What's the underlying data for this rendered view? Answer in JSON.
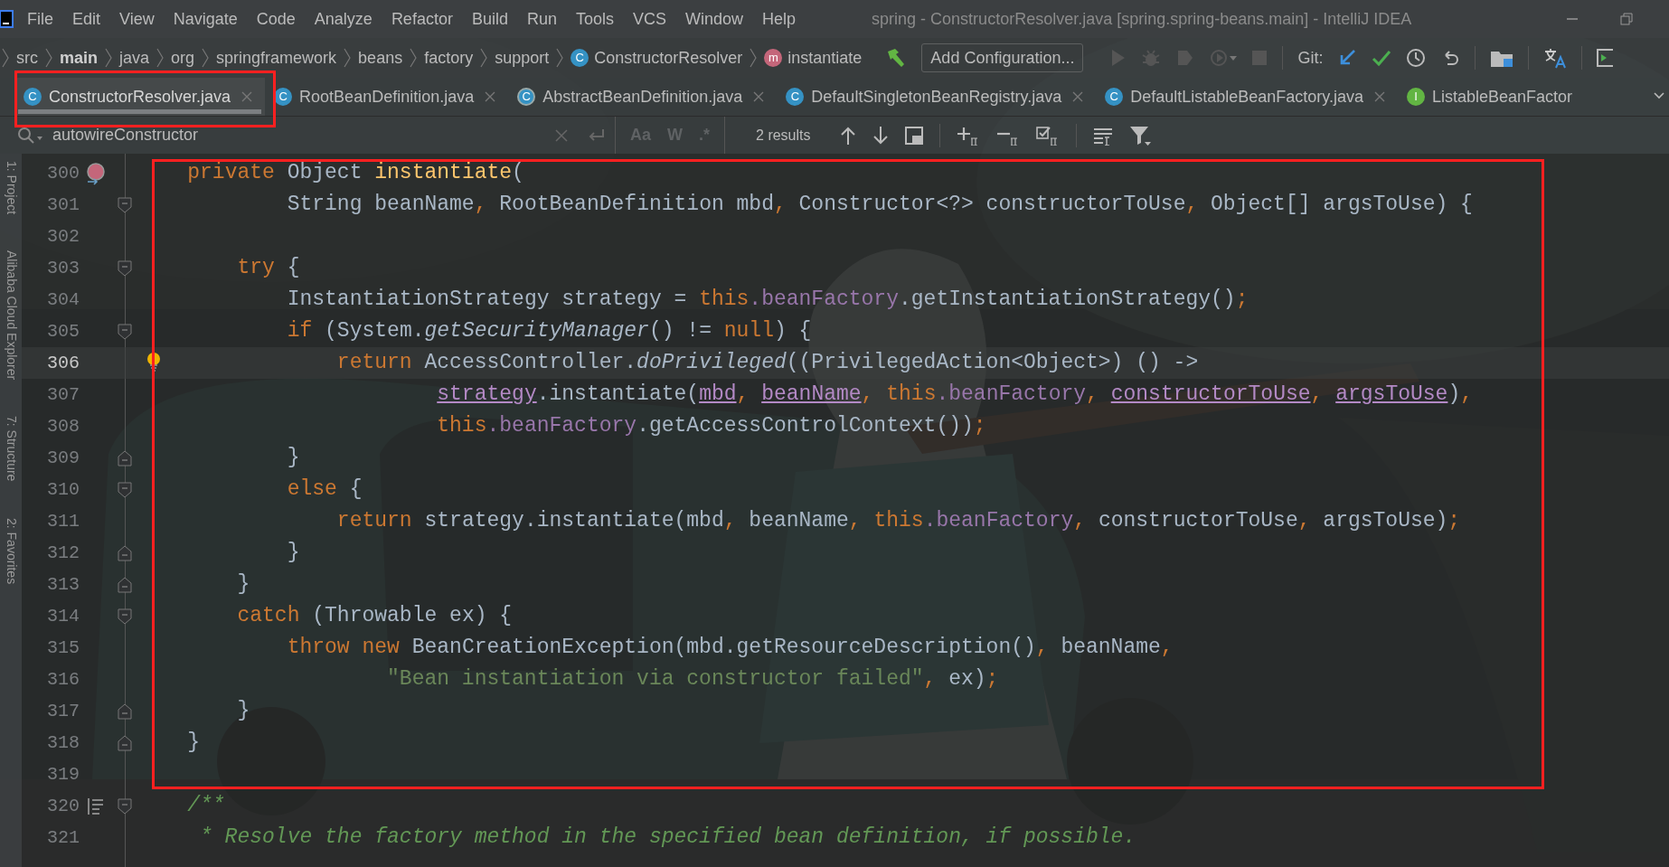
{
  "menu_bar": {
    "items": [
      "File",
      "Edit",
      "View",
      "Navigate",
      "Code",
      "Analyze",
      "Refactor",
      "Build",
      "Run",
      "Tools",
      "VCS",
      "Window",
      "Help"
    ]
  },
  "window": {
    "title": "spring - ConstructorResolver.java [spring.spring-beans.main] - IntelliJ IDEA"
  },
  "breadcrumbs": [
    {
      "label": "src",
      "kind": "folder"
    },
    {
      "label": "main",
      "kind": "bold"
    },
    {
      "label": "java",
      "kind": "folder"
    },
    {
      "label": "org",
      "kind": "folder"
    },
    {
      "label": "springframework",
      "kind": "folder"
    },
    {
      "label": "beans",
      "kind": "folder"
    },
    {
      "label": "factory",
      "kind": "folder"
    },
    {
      "label": "support",
      "kind": "folder"
    },
    {
      "label": "ConstructorResolver",
      "kind": "class",
      "icon_letter": "C"
    },
    {
      "label": "instantiate",
      "kind": "method",
      "icon_letter": "m"
    }
  ],
  "toolbar": {
    "run_config": "Add Configuration...",
    "vcs_label": "Git:"
  },
  "tabs": [
    {
      "label": "ConstructorResolver.java",
      "kind": "class",
      "icon_letter": "C",
      "selected": true
    },
    {
      "label": "RootBeanDefinition.java",
      "kind": "class",
      "icon_letter": "C",
      "selected": false
    },
    {
      "label": "AbstractBeanDefinition.java",
      "kind": "abstract",
      "icon_letter": "C",
      "selected": false
    },
    {
      "label": "DefaultSingletonBeanRegistry.java",
      "kind": "class",
      "icon_letter": "C",
      "selected": false
    },
    {
      "label": "DefaultListableBeanFactory.java",
      "kind": "class",
      "icon_letter": "C",
      "selected": false
    },
    {
      "label": "ListableBeanFactor",
      "kind": "interface",
      "icon_letter": "I",
      "selected": false
    }
  ],
  "find_bar": {
    "query": "autowireConstructor",
    "options": [
      {
        "label": "Aa",
        "on": false
      },
      {
        "label": "W",
        "on": false
      },
      {
        "label": ".*",
        "on": false
      }
    ],
    "result_count": "2 results"
  },
  "tool_strip": [
    "1: Project",
    "Alibaba Cloud Explorer",
    "7: Structure",
    "2: Favorites"
  ],
  "editor": {
    "lines": [
      {
        "number": "300",
        "current": false,
        "gutter_icon": {
          "kind": "override"
        },
        "tokens": [
          {
            "text": "    private ",
            "kind": "keyword"
          },
          {
            "text": "Object ",
            "kind": "plain"
          },
          {
            "text": "instantiate",
            "kind": "method"
          },
          {
            "text": "(",
            "kind": "plain"
          }
        ]
      },
      {
        "number": "301",
        "current": false,
        "fold_marker": {
          "kind": "start"
        },
        "tokens": [
          {
            "text": "            String beanName, RootBeanDefinition mbd, Constructor<?> constructorToUse, Object[] argsToUse) {",
            "kind": "plain"
          }
        ]
      },
      {
        "number": "302",
        "current": false
      },
      {
        "number": "303",
        "current": false,
        "fold_marker": {
          "kind": "start"
        },
        "tokens": [
          {
            "text": "        try",
            "kind": "keyword"
          },
          {
            "text": " {",
            "kind": "plain"
          }
        ]
      },
      {
        "number": "304",
        "current": false,
        "tokens": [
          {
            "text": "            InstantiationStrategy strategy = ",
            "kind": "plain"
          },
          {
            "text": "this",
            "kind": "keyword"
          },
          {
            "text": ".beanFactory",
            "kind": "field"
          },
          {
            "text": ".getInstantiationStrategy();",
            "kind": "plain"
          }
        ]
      },
      {
        "number": "305",
        "current": false,
        "fold_marker": {
          "kind": "start"
        },
        "tokens": [
          {
            "text": "            if ",
            "kind": "keyword"
          },
          {
            "text": "(System.",
            "kind": "plain"
          },
          {
            "text": "getSecurityManager",
            "kind": "static"
          },
          {
            "text": "() != ",
            "kind": "plain"
          },
          {
            "text": "null",
            "kind": "keyword"
          },
          {
            "text": ") {",
            "kind": "plain"
          }
        ]
      },
      {
        "number": "306",
        "current": true,
        "gutter_icon": {
          "kind": "bulb"
        },
        "tokens": [
          {
            "text": "                return ",
            "kind": "keyword"
          },
          {
            "text": "AccessController.",
            "kind": "plain"
          },
          {
            "text": "doPrivileged",
            "kind": "static"
          },
          {
            "text": "((PrivilegedAction<Object>) () ->",
            "kind": "plain"
          }
        ]
      },
      {
        "number": "307",
        "current": false,
        "tokens": [
          {
            "text": "                        strategy",
            "kind": "captured"
          },
          {
            "text": ".instantiate(",
            "kind": "plain"
          },
          {
            "text": "mbd",
            "kind": "captured"
          },
          {
            "text": ", ",
            "kind": "plain"
          },
          {
            "text": "beanName",
            "kind": "captured"
          },
          {
            "text": ", ",
            "kind": "plain"
          },
          {
            "text": "this",
            "kind": "keyword"
          },
          {
            "text": ".beanFactory",
            "kind": "field"
          },
          {
            "text": ", ",
            "kind": "plain"
          },
          {
            "text": "constructorToUse",
            "kind": "captured"
          },
          {
            "text": ", ",
            "kind": "plain"
          },
          {
            "text": "argsToUse",
            "kind": "captured"
          },
          {
            "text": "),",
            "kind": "plain"
          }
        ]
      },
      {
        "number": "308",
        "current": false,
        "tokens": [
          {
            "text": "                        this",
            "kind": "keyword"
          },
          {
            "text": ".beanFactory",
            "kind": "field"
          },
          {
            "text": ".getAccessControlContext());",
            "kind": "plain"
          }
        ]
      },
      {
        "number": "309",
        "current": false,
        "fold_marker": {
          "kind": "end"
        },
        "tokens": [
          {
            "text": "            }",
            "kind": "plain"
          }
        ]
      },
      {
        "number": "310",
        "current": false,
        "fold_marker": {
          "kind": "start"
        },
        "tokens": [
          {
            "text": "            else",
            "kind": "keyword"
          },
          {
            "text": " {",
            "kind": "plain"
          }
        ]
      },
      {
        "number": "311",
        "current": false,
        "tokens": [
          {
            "text": "                return ",
            "kind": "keyword"
          },
          {
            "text": "strategy.instantiate(mbd, beanName, ",
            "kind": "plain"
          },
          {
            "text": "this",
            "kind": "keyword"
          },
          {
            "text": ".beanFactory",
            "kind": "field"
          },
          {
            "text": ", constructorToUse, argsToUse);",
            "kind": "plain"
          }
        ]
      },
      {
        "number": "312",
        "current": false,
        "fold_marker": {
          "kind": "end"
        },
        "tokens": [
          {
            "text": "            }",
            "kind": "plain"
          }
        ]
      },
      {
        "number": "313",
        "current": false,
        "fold_marker": {
          "kind": "end"
        },
        "tokens": [
          {
            "text": "        }",
            "kind": "plain"
          }
        ]
      },
      {
        "number": "314",
        "current": false,
        "fold_marker": {
          "kind": "start"
        },
        "tokens": [
          {
            "text": "        catch ",
            "kind": "keyword"
          },
          {
            "text": "(Throwable ex) {",
            "kind": "plain"
          }
        ]
      },
      {
        "number": "315",
        "current": false,
        "tokens": [
          {
            "text": "            throw new ",
            "kind": "keyword"
          },
          {
            "text": "BeanCreationException(mbd.getResourceDescription(), beanName,",
            "kind": "plain"
          }
        ]
      },
      {
        "number": "316",
        "current": false,
        "tokens": [
          {
            "text": "                    \"Bean instantiation via constructor failed\"",
            "kind": "string"
          },
          {
            "text": ", ex);",
            "kind": "plain"
          }
        ]
      },
      {
        "number": "317",
        "current": false,
        "fold_marker": {
          "kind": "end"
        },
        "tokens": [
          {
            "text": "        }",
            "kind": "plain"
          }
        ]
      },
      {
        "number": "318",
        "current": false,
        "fold_marker": {
          "kind": "end"
        },
        "tokens": [
          {
            "text": "    }",
            "kind": "plain"
          }
        ]
      },
      {
        "number": "319",
        "current": false
      },
      {
        "number": "320",
        "current": false,
        "gutter_icon": {
          "kind": "doc"
        },
        "fold_marker": {
          "kind": "start"
        },
        "tokens": [
          {
            "text": "    /**",
            "kind": "comment"
          }
        ]
      },
      {
        "number": "321",
        "current": false,
        "tokens": [
          {
            "text": "     * Resolve the factory method in the specified bean definition, if possible.",
            "kind": "comment"
          }
        ]
      }
    ]
  }
}
